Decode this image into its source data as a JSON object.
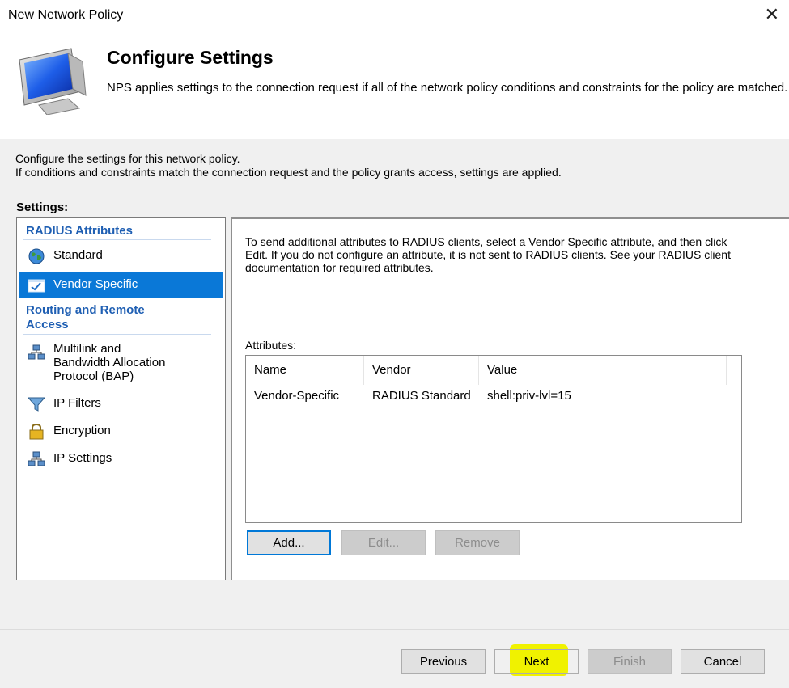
{
  "window": {
    "title": "New Network Policy",
    "close_glyph": "✕"
  },
  "header": {
    "icon": "monitor-icon",
    "title": "Configure Settings",
    "description": "NPS applies settings to the connection request if all of the network policy conditions and constraints for the policy are matched."
  },
  "intro": {
    "line1": "Configure the settings for this network policy.",
    "line2": "If conditions and constraints match the connection request and the policy grants access, settings are applied."
  },
  "settings": {
    "label": "Settings:",
    "groups": [
      {
        "title": "RADIUS Attributes",
        "items": [
          {
            "label": "Standard",
            "icon": "globe-icon",
            "selected": false
          },
          {
            "label": "Vendor Specific",
            "icon": "checkbox-window-icon",
            "selected": true
          }
        ]
      },
      {
        "title_line1": "Routing and Remote",
        "title_line2": "Access",
        "items": [
          {
            "line1": "Multilink and",
            "line2": "Bandwidth Allocation",
            "line3": "Protocol (BAP)",
            "icon": "network-icon"
          },
          {
            "label": "IP Filters",
            "icon": "funnel-icon"
          },
          {
            "label": "Encryption",
            "icon": "lock-icon"
          },
          {
            "label": "IP Settings",
            "icon": "network-icon"
          }
        ]
      }
    ]
  },
  "vendor_panel": {
    "description": "To send additional attributes to RADIUS clients, select a Vendor Specific attribute, and then click Edit. If you do not configure an attribute, it is not sent to RADIUS clients. See your RADIUS client documentation for required attributes.",
    "attributes_label": "Attributes:",
    "columns": [
      "Name",
      "Vendor",
      "Value"
    ],
    "rows": [
      {
        "name": "Vendor-Specific",
        "vendor": "RADIUS Standard",
        "value": "shell:priv-lvl=15"
      }
    ],
    "buttons": {
      "add": "Add...",
      "edit": "Edit...",
      "remove": "Remove"
    }
  },
  "footer": {
    "previous": "Previous",
    "next": "Next",
    "finish": "Finish",
    "cancel": "Cancel",
    "highlight_color": "#f0f200"
  },
  "colors": {
    "accent": "#0a78d7",
    "group_heading": "#1f5fb3",
    "body_bg": "#f0f0f0"
  }
}
